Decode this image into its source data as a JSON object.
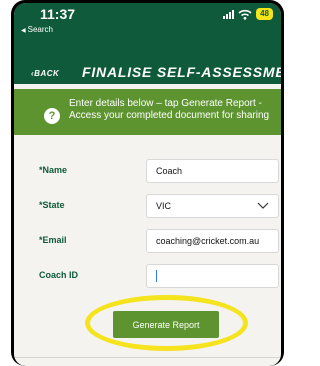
{
  "status_bar": {
    "time": "11:37",
    "back_app": "Search",
    "battery": "48"
  },
  "nav": {
    "back_label": "‹BACK",
    "title": "FINALISE SELF-ASSESSMENT"
  },
  "info": {
    "icon": "question-icon",
    "text": "Enter details below – tap Generate Report - Access your completed document for sharing"
  },
  "form": {
    "fields": [
      {
        "label": "*Name",
        "value": "Coach"
      },
      {
        "label": "*State",
        "value": "VIC",
        "type": "select"
      },
      {
        "label": "*Email",
        "value": "coaching@cricket.com.au"
      },
      {
        "label": "Coach ID",
        "value": ""
      }
    ]
  },
  "actions": {
    "generate_label": "Generate Report"
  },
  "colors": {
    "header_bg": "#0f5a3a",
    "accent_green": "#5e9430",
    "highlight_yellow": "#f4e31d"
  }
}
